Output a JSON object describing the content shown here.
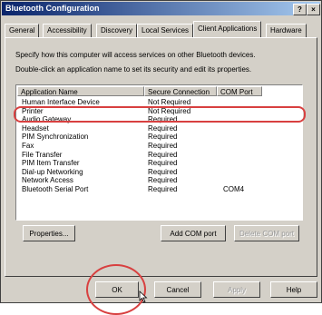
{
  "window": {
    "title": "Bluetooth Configuration",
    "help_glyph": "?",
    "close_glyph": "×"
  },
  "tabs": [
    {
      "label": "General"
    },
    {
      "label": "Accessibility"
    },
    {
      "label": "Discovery"
    },
    {
      "label": "Local Services"
    },
    {
      "label": "Client Applications"
    },
    {
      "label": "Hardware"
    }
  ],
  "descriptions": {
    "line1": "Specify how this computer will access services on other Bluetooth devices.",
    "line2": "Double-click an application name to set its security and edit its properties."
  },
  "table": {
    "columns": [
      "Application Name",
      "Secure Connection",
      "COM Port"
    ],
    "rows": [
      {
        "name": "Human Interface Device",
        "secure": "Not Required",
        "com": ""
      },
      {
        "name": "Printer",
        "secure": "Not Required",
        "com": ""
      },
      {
        "name": "Audio Gateway",
        "secure": "Required",
        "com": ""
      },
      {
        "name": "Headset",
        "secure": "Required",
        "com": ""
      },
      {
        "name": "PIM Synchronization",
        "secure": "Required",
        "com": ""
      },
      {
        "name": "Fax",
        "secure": "Required",
        "com": ""
      },
      {
        "name": "File Transfer",
        "secure": "Required",
        "com": ""
      },
      {
        "name": "PIM Item Transfer",
        "secure": "Required",
        "com": ""
      },
      {
        "name": "Dial-up Networking",
        "secure": "Required",
        "com": ""
      },
      {
        "name": "Network Access",
        "secure": "Required",
        "com": ""
      },
      {
        "name": "Bluetooth Serial Port",
        "secure": "Required",
        "com": "COM4"
      }
    ]
  },
  "buttons": {
    "properties": "Properties...",
    "add_com": "Add COM port",
    "delete_com": "Delete COM port",
    "ok": "OK",
    "cancel": "Cancel",
    "apply": "Apply",
    "help": "Help"
  },
  "colors": {
    "annotation_red": "#d84040",
    "title_start": "#0a246a"
  }
}
